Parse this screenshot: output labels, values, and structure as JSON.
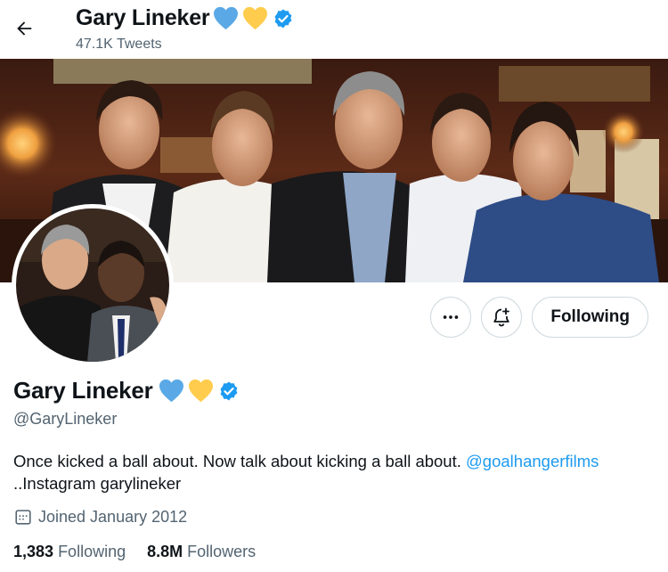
{
  "header": {
    "display_name": "Gary Lineker",
    "tweet_count": "47.1K Tweets",
    "icons": [
      "back-arrow-icon",
      "blue-heart-icon",
      "yellow-heart-icon",
      "verified-badge-icon"
    ]
  },
  "actions": {
    "more_icon": "more-icon",
    "notify_icon": "bell-plus-icon",
    "follow_label": "Following"
  },
  "profile": {
    "display_name": "Gary Lineker",
    "handle": "@GaryLineker",
    "bio_text": "Once kicked a ball about. Now talk about kicking a ball about. ",
    "bio_link": "@goalhangerfilms",
    "bio_text2": "..Instagram garylineker",
    "joined": "Joined January 2012",
    "following_count": "1,383",
    "following_label": "Following",
    "followers_count": "8.8M",
    "followers_label": "Followers"
  },
  "colors": {
    "accent": "#1d9bf0",
    "heart_blue": "#5aa9e6",
    "heart_yellow": "#ffcc4d",
    "secondary_text": "#536471"
  }
}
